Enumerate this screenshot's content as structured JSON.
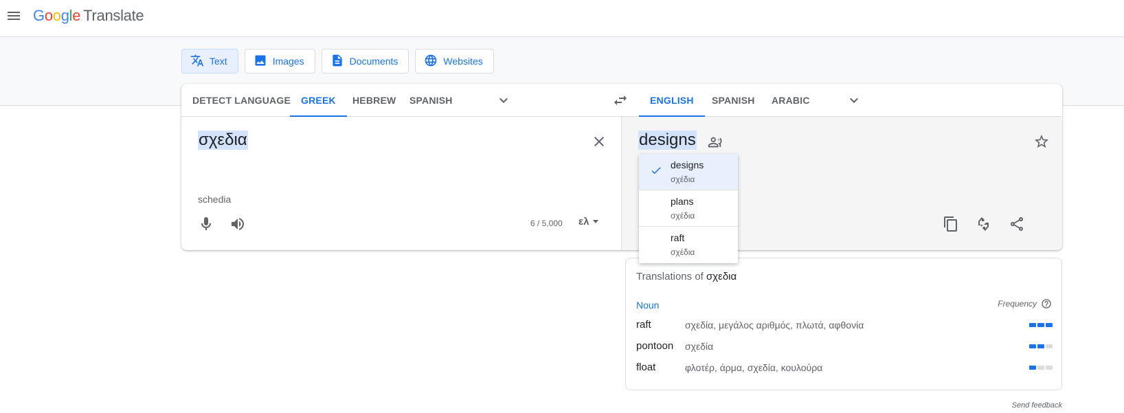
{
  "app": {
    "logo_letters": [
      "G",
      "o",
      "o",
      "g",
      "l",
      "e"
    ],
    "product": "Translate"
  },
  "modes": [
    {
      "label": "Text",
      "icon": "translate-icon",
      "active": true
    },
    {
      "label": "Images",
      "icon": "image-icon",
      "active": false
    },
    {
      "label": "Documents",
      "icon": "document-icon",
      "active": false
    },
    {
      "label": "Websites",
      "icon": "globe-icon",
      "active": false
    }
  ],
  "source_langs": [
    {
      "label": "DETECT LANGUAGE",
      "active": false
    },
    {
      "label": "GREEK",
      "active": true
    },
    {
      "label": "HEBREW",
      "active": false
    },
    {
      "label": "SPANISH",
      "active": false
    }
  ],
  "target_langs": [
    {
      "label": "ENGLISH",
      "active": true
    },
    {
      "label": "SPANISH",
      "active": false
    },
    {
      "label": "ARABIC",
      "active": false
    }
  ],
  "source": {
    "text": "σχεδια",
    "transliteration": "schedia",
    "char_count": "6 / 5,000",
    "ime_label": "ελ"
  },
  "target": {
    "text": "designs"
  },
  "alternatives": [
    {
      "word": "designs",
      "source": "σχέδια",
      "selected": true
    },
    {
      "word": "plans",
      "source": "σχέδια",
      "selected": false
    },
    {
      "word": "raft",
      "source": "σχέδια",
      "selected": false
    }
  ],
  "dictionary": {
    "title_prefix": "Translations of",
    "title_word": "σχεδια",
    "part_of_speech": "Noun",
    "frequency_label": "Frequency",
    "entries": [
      {
        "word": "raft",
        "synonyms": "σχεδία, μεγάλος αριθμός, πλωτά, αφθονία",
        "frequency": 3
      },
      {
        "word": "pontoon",
        "synonyms": "σχεδία",
        "frequency": 2
      },
      {
        "word": "float",
        "synonyms": "φλοτέρ, άρμα, σχεδία, κουλούρα",
        "frequency": 1
      }
    ]
  },
  "feedback_label": "Send feedback",
  "colors": {
    "accent": "#1a73e8",
    "muted": "#5f6368",
    "highlight": "#d3e3fd"
  }
}
